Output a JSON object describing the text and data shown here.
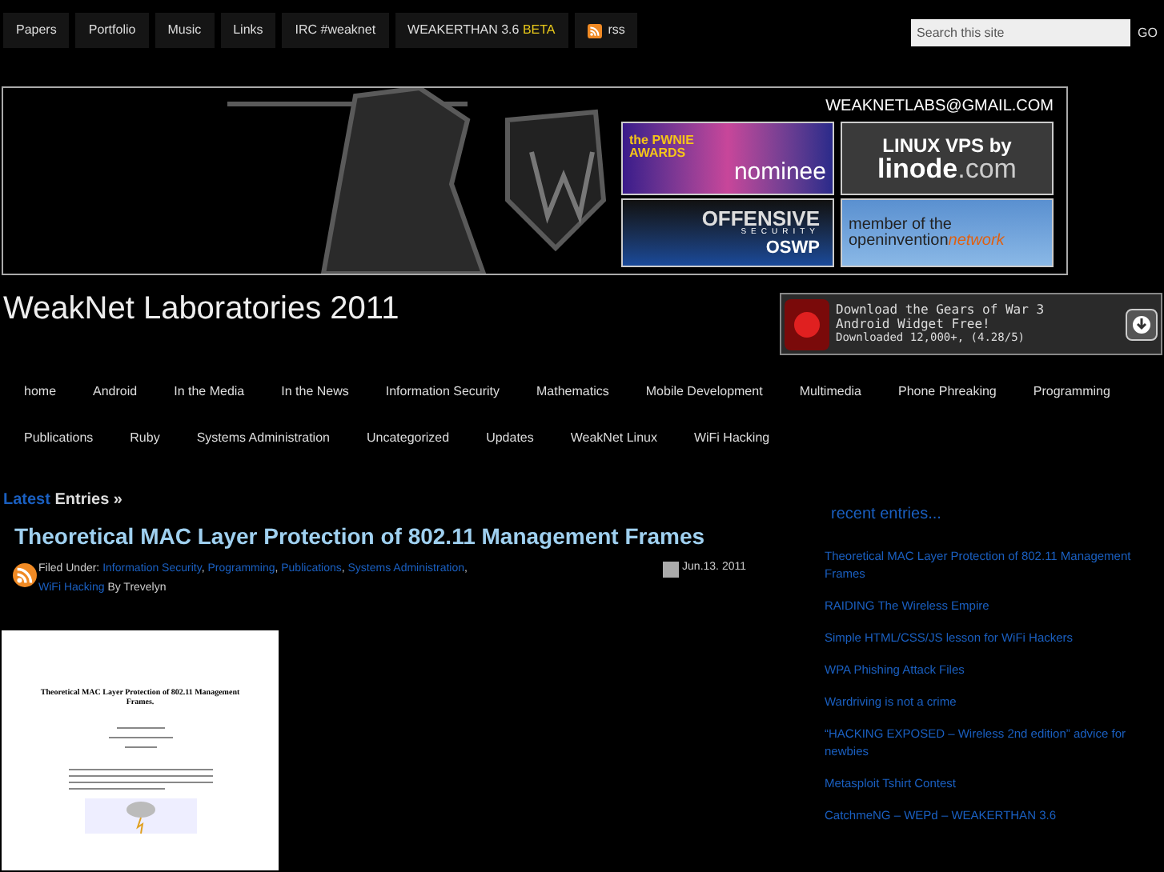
{
  "top_nav": [
    {
      "kind": "link",
      "label": "Papers"
    },
    {
      "kind": "link",
      "label": "Portfolio"
    },
    {
      "kind": "link",
      "label": "Music"
    },
    {
      "kind": "link",
      "label": "Links"
    },
    {
      "kind": "link",
      "label": "IRC #weaknet"
    },
    {
      "kind": "tagged",
      "label": "WEAKERTHAN 3.6",
      "tag": "BETA"
    },
    {
      "kind": "rss",
      "label": "rss"
    }
  ],
  "search": {
    "placeholder": "Search this site",
    "button": "GO"
  },
  "banner": {
    "email": "WEAKNETLABS@GMAIL.COM",
    "badges": [
      {
        "kind": "pwnie",
        "lines": [
          "the",
          "PWNIE",
          "AWARDS",
          "nominee"
        ]
      },
      {
        "kind": "linode",
        "lines": [
          "LINUX VPS by",
          "linode",
          ".com"
        ]
      },
      {
        "kind": "offsec",
        "lines": [
          "OFFENSIVE",
          "SECURITY",
          "OSWP"
        ]
      },
      {
        "kind": "oin",
        "lines": [
          "member of the",
          "openinvention",
          "network"
        ]
      }
    ]
  },
  "site_title": "WeakNet Laboratories 2011",
  "ad": {
    "lines": [
      "Download the Gears of War 3",
      "Android Widget Free!",
      "Downloaded 12,000+, (4.28/5)"
    ]
  },
  "categories": [
    [
      "home",
      "Android",
      "In the Media",
      "In the News",
      "Information Security",
      "Mathematics",
      "Mobile Development",
      "Multimedia",
      "Phone Phreaking",
      "Programming"
    ],
    [
      "Publications",
      "Ruby",
      "Systems Administration",
      "Uncategorized",
      "Updates",
      "WeakNet Linux",
      "WiFi Hacking"
    ]
  ],
  "latest": {
    "accent": "Latest",
    "rest": "Entries »"
  },
  "post": {
    "title": "Theoretical MAC Layer Protection of 802.11 Management Frames",
    "filed_label": "Filed Under:",
    "separator": ",",
    "categories": [
      "Information Security",
      "Programming",
      "Publications",
      "Systems Administration",
      "WiFi Hacking"
    ],
    "by": "By Trevelyn",
    "date": "Jun.13. 2011",
    "document": {
      "title": "Theoretical MAC Layer Protection of 802.11 Management Frames."
    }
  },
  "sidebar": {
    "heading": "recent entries...",
    "entries": [
      "Theoretical MAC Layer Protection of 802.11 Management Frames",
      "RAIDING The Wireless Empire",
      "Simple HTML/CSS/JS lesson for WiFi Hackers",
      "WPA Phishing Attack Files",
      "Wardriving is not a crime",
      "“HACKING EXPOSED – Wireless 2nd edition” advice for newbies",
      "Metasploit Tshirt Contest",
      "CatchmeNG – WEPd – WEAKERTHAN 3.6"
    ]
  }
}
